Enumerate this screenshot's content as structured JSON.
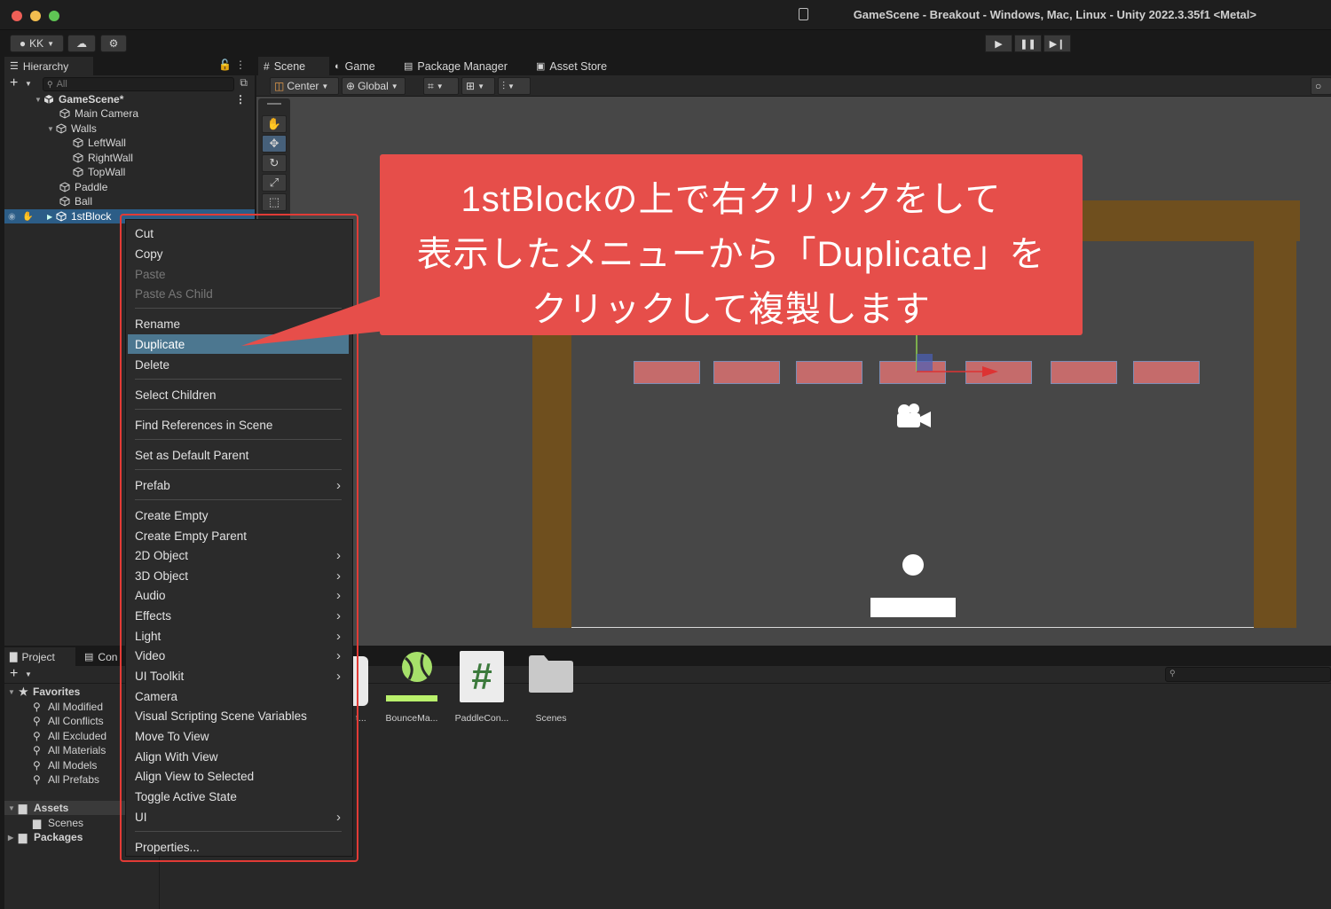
{
  "window": {
    "title": "GameScene - Breakout - Windows, Mac, Linux - Unity 2022.3.35f1 <Metal>"
  },
  "toolbar": {
    "account_label": "KK"
  },
  "hierarchy": {
    "tab_label": "Hierarchy",
    "search_placeholder": "All",
    "items": [
      {
        "label": "GameScene*"
      },
      {
        "label": "Main Camera"
      },
      {
        "label": "Walls"
      },
      {
        "label": "LeftWall"
      },
      {
        "label": "RightWall"
      },
      {
        "label": "TopWall"
      },
      {
        "label": "Paddle"
      },
      {
        "label": "Ball"
      },
      {
        "label": "1stBlock"
      }
    ]
  },
  "scene": {
    "tabs": [
      {
        "label": "Scene"
      },
      {
        "label": "Game"
      },
      {
        "label": "Package Manager"
      },
      {
        "label": "Asset Store"
      }
    ],
    "pivot_label": "Center",
    "space_label": "Global"
  },
  "bottom": {
    "tabs": [
      {
        "label": "Project"
      },
      {
        "label": "Con"
      }
    ],
    "favorites_label": "Favorites",
    "favorites": [
      {
        "label": "All Modified"
      },
      {
        "label": "All Conflicts"
      },
      {
        "label": "All Excluded"
      },
      {
        "label": "All Materials"
      },
      {
        "label": "All Models"
      },
      {
        "label": "All Prefabs"
      }
    ],
    "assets_label": "Assets",
    "scenes_label": "Scenes",
    "packages_label": "Packages",
    "asset_items": [
      {
        "label": "t..."
      },
      {
        "label": "BounceMa..."
      },
      {
        "label": "PaddleCon..."
      },
      {
        "label": "Scenes"
      }
    ]
  },
  "context_menu": {
    "items": [
      {
        "label": "Cut"
      },
      {
        "label": "Copy"
      },
      {
        "label": "Paste"
      },
      {
        "label": "Paste As Child"
      },
      {
        "label": "Rename"
      },
      {
        "label": "Duplicate"
      },
      {
        "label": "Delete"
      },
      {
        "label": "Select Children"
      },
      {
        "label": "Find References in Scene"
      },
      {
        "label": "Set as Default Parent"
      },
      {
        "label": "Prefab"
      },
      {
        "label": "Create Empty"
      },
      {
        "label": "Create Empty Parent"
      },
      {
        "label": "2D Object"
      },
      {
        "label": "3D Object"
      },
      {
        "label": "Audio"
      },
      {
        "label": "Effects"
      },
      {
        "label": "Light"
      },
      {
        "label": "Video"
      },
      {
        "label": "UI Toolkit"
      },
      {
        "label": "Camera"
      },
      {
        "label": "Visual Scripting Scene Variables"
      },
      {
        "label": "Move To View"
      },
      {
        "label": "Align With View"
      },
      {
        "label": "Align View to Selected"
      },
      {
        "label": "Toggle Active State"
      },
      {
        "label": "UI"
      },
      {
        "label": "Properties..."
      }
    ]
  },
  "callout": {
    "lines": [
      "1stBlockの上で右クリックをして",
      "表示したメニューから「Duplicate」を",
      "クリックして複製します"
    ]
  },
  "colors": {
    "accent_selection": "#4c7790",
    "callout_red": "#e64e4a",
    "highlight_frame": "#e23b36",
    "wall_brown": "#6f4f1e",
    "block_red": "#c56b6b"
  }
}
